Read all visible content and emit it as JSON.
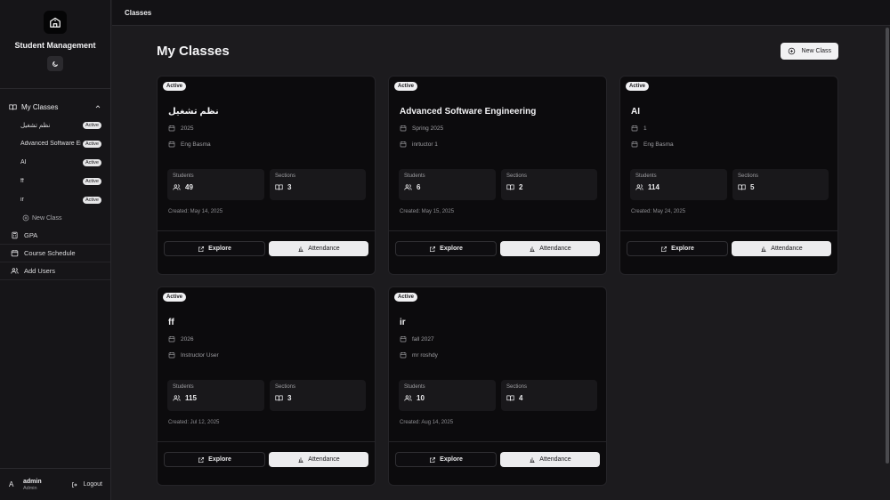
{
  "app": {
    "title": "Student Management"
  },
  "topbar": {
    "title": "Classes"
  },
  "sidebar": {
    "my_classes_label": "My Classes",
    "classes": [
      {
        "name": "نظم تشغيل",
        "badge": "Active"
      },
      {
        "name": "Advanced Software Engineering",
        "badge": "Active"
      },
      {
        "name": "AI",
        "badge": "Active"
      },
      {
        "name": "ff",
        "badge": "Active"
      },
      {
        "name": "ir",
        "badge": "Active"
      }
    ],
    "new_class_label": "New Class",
    "items": [
      {
        "label": "GPA",
        "icon": "calculator-icon"
      },
      {
        "label": "Course Schedule",
        "icon": "calendar-icon"
      },
      {
        "label": "Add Users",
        "icon": "users-icon"
      }
    ]
  },
  "user": {
    "avatar": "A",
    "name": "admin",
    "role": "Admin",
    "logout_label": "Logout"
  },
  "main": {
    "title": "My Classes",
    "new_class_button": "New Class"
  },
  "card_labels": {
    "students": "Students",
    "sections": "Sections",
    "explore": "Explore",
    "attendance": "Attendance"
  },
  "classes": [
    {
      "status": "Active",
      "title": "نظم تشغيل",
      "term": "2025",
      "instructor": "Eng Basma",
      "students": "49",
      "sections": "3",
      "created": "Created: May 14, 2025"
    },
    {
      "status": "Active",
      "title": "Advanced Software Engineering",
      "term": "Spring 2025",
      "instructor": "inrtuctor 1",
      "students": "6",
      "sections": "2",
      "created": "Created: May 15, 2025"
    },
    {
      "status": "Active",
      "title": "AI",
      "term": "1",
      "instructor": "Eng Basma",
      "students": "114",
      "sections": "5",
      "created": "Created: May 24, 2025"
    },
    {
      "status": "Active",
      "title": "ff",
      "term": "2026",
      "instructor": "Instructor User",
      "students": "115",
      "sections": "3",
      "created": "Created: Jul 12, 2025"
    },
    {
      "status": "Active",
      "title": "ir",
      "term": "fall 2027",
      "instructor": "mr roshdy",
      "students": "10",
      "sections": "4",
      "created": "Created: Aug 14, 2025"
    }
  ],
  "colors": {
    "background": "#1c1b1e",
    "card": "#0c0b0d",
    "accent": "#ececee"
  }
}
